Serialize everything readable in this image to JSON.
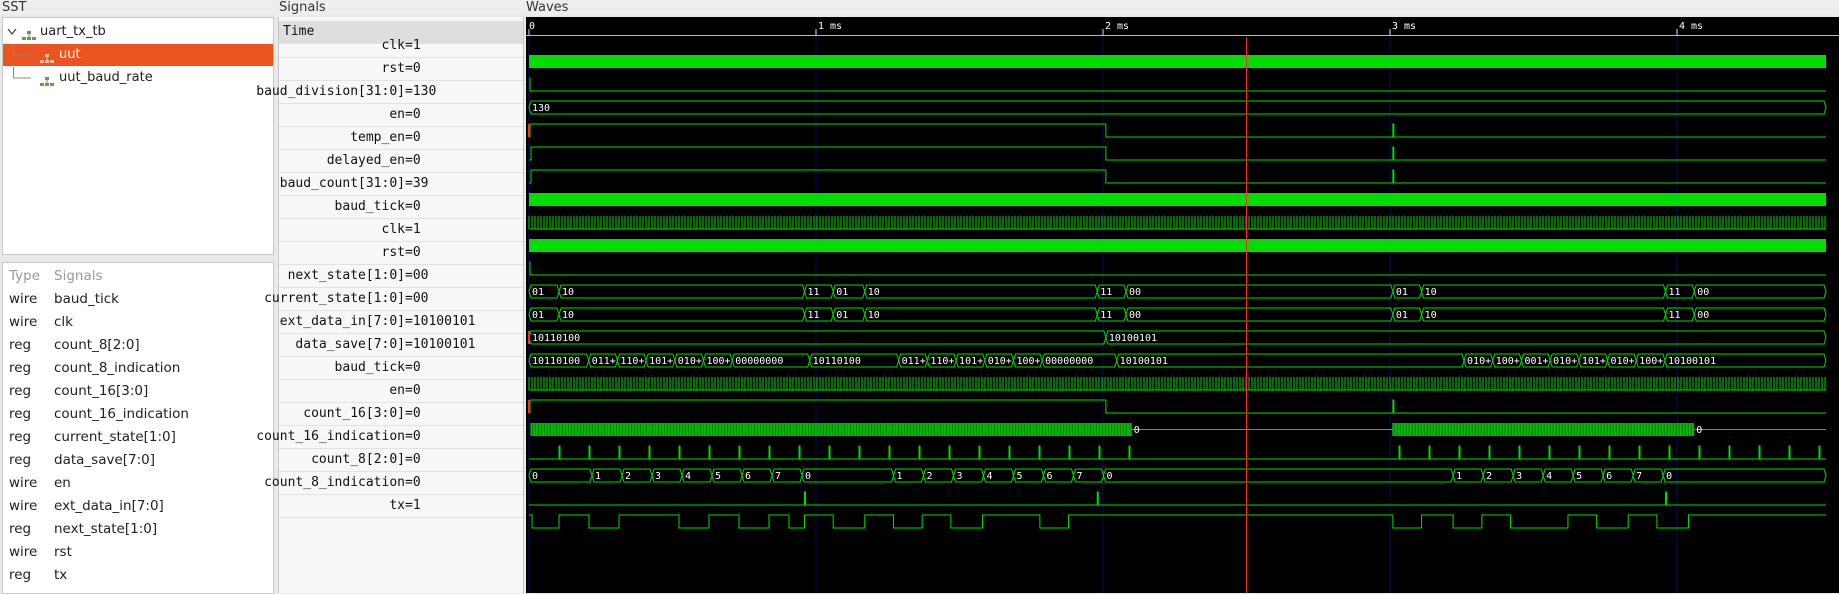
{
  "sst": {
    "title": "SST",
    "tree": [
      {
        "label": "uart_tx_tb",
        "depth": 0,
        "selected": false
      },
      {
        "label": "uut",
        "depth": 1,
        "selected": true
      },
      {
        "label": "uut_baud_rate",
        "depth": 1,
        "selected": false
      }
    ],
    "signal_list": {
      "header_type": "Type",
      "header_signals": "Signals",
      "rows": [
        {
          "type": "wire",
          "name": "baud_tick"
        },
        {
          "type": "wire",
          "name": "clk"
        },
        {
          "type": "reg",
          "name": "count_8[2:0]"
        },
        {
          "type": "reg",
          "name": "count_8_indication"
        },
        {
          "type": "reg",
          "name": "count_16[3:0]"
        },
        {
          "type": "reg",
          "name": "count_16_indication"
        },
        {
          "type": "reg",
          "name": "current_state[1:0]"
        },
        {
          "type": "reg",
          "name": "data_save[7:0]"
        },
        {
          "type": "wire",
          "name": "en"
        },
        {
          "type": "wire",
          "name": "ext_data_in[7:0]"
        },
        {
          "type": "reg",
          "name": "next_state[1:0]"
        },
        {
          "type": "wire",
          "name": "rst"
        },
        {
          "type": "reg",
          "name": "tx"
        }
      ]
    }
  },
  "signals": {
    "title": "Signals",
    "time_header": "Time",
    "rows": [
      {
        "name": "clk",
        "value": "=1"
      },
      {
        "name": "rst",
        "value": "=0"
      },
      {
        "name": "baud_division[31:0]",
        "value": "=130"
      },
      {
        "name": "en",
        "value": "=0"
      },
      {
        "name": "temp_en",
        "value": "=0"
      },
      {
        "name": "delayed_en",
        "value": "=0"
      },
      {
        "name": "baud_count[31:0]",
        "value": "=39"
      },
      {
        "name": "baud_tick",
        "value": "=0"
      },
      {
        "name": "clk",
        "value": "=1"
      },
      {
        "name": "rst",
        "value": "=0"
      },
      {
        "name": "next_state[1:0]",
        "value": "=00"
      },
      {
        "name": "current_state[1:0]",
        "value": "=00"
      },
      {
        "name": "ext_data_in[7:0]",
        "value": "=10100101"
      },
      {
        "name": "data_save[7:0]",
        "value": "=10100101"
      },
      {
        "name": "baud_tick",
        "value": "=0"
      },
      {
        "name": "en",
        "value": "=0"
      },
      {
        "name": "count_16[3:0]",
        "value": "=0"
      },
      {
        "name": "count_16_indication",
        "value": "=0"
      },
      {
        "name": "count_8[2:0]",
        "value": "=0"
      },
      {
        "name": "count_8_indication",
        "value": "=0"
      },
      {
        "name": "tx",
        "value": "=1"
      }
    ]
  },
  "waves": {
    "title": "Waves",
    "time_labels": [
      "0",
      "1 ms",
      "2 ms",
      "3 ms",
      "4 ms"
    ],
    "marker_time_ms": 2.5,
    "colors": {
      "wave": "#00dd00",
      "background": "#000000",
      "grid": "#0a0a66",
      "marker": "#ff2a2a",
      "x_state": "#ff2a2a"
    },
    "bus_labels": {
      "baud_division": [
        "130"
      ],
      "next_state": [
        "01",
        "10",
        "11",
        "01",
        "10",
        "11",
        "00",
        "01",
        "10",
        "11",
        "00"
      ],
      "current_state": [
        "01",
        "10",
        "11",
        "01",
        "10",
        "11",
        "00",
        "01",
        "10",
        "11",
        "00"
      ],
      "ext_data_in": [
        "10110100",
        "10100101"
      ],
      "data_save": [
        "10110100",
        "011+",
        "110+",
        "101+",
        "010+",
        "100+",
        "00000000",
        "10110100",
        "011+",
        "110+",
        "101+",
        "010+",
        "100+",
        "00000000",
        "10100101",
        "010+",
        "100+",
        "001+",
        "010+",
        "101+",
        "010+",
        "100+",
        "10100101"
      ],
      "count_16": [
        "0",
        "0"
      ],
      "count_8": [
        "0",
        "1",
        "2",
        "3",
        "4",
        "5",
        "6",
        "7",
        "0",
        "1",
        "2",
        "3",
        "4",
        "5",
        "6",
        "7",
        "0",
        "1",
        "2",
        "3",
        "4",
        "5",
        "6",
        "7",
        "0"
      ]
    }
  }
}
